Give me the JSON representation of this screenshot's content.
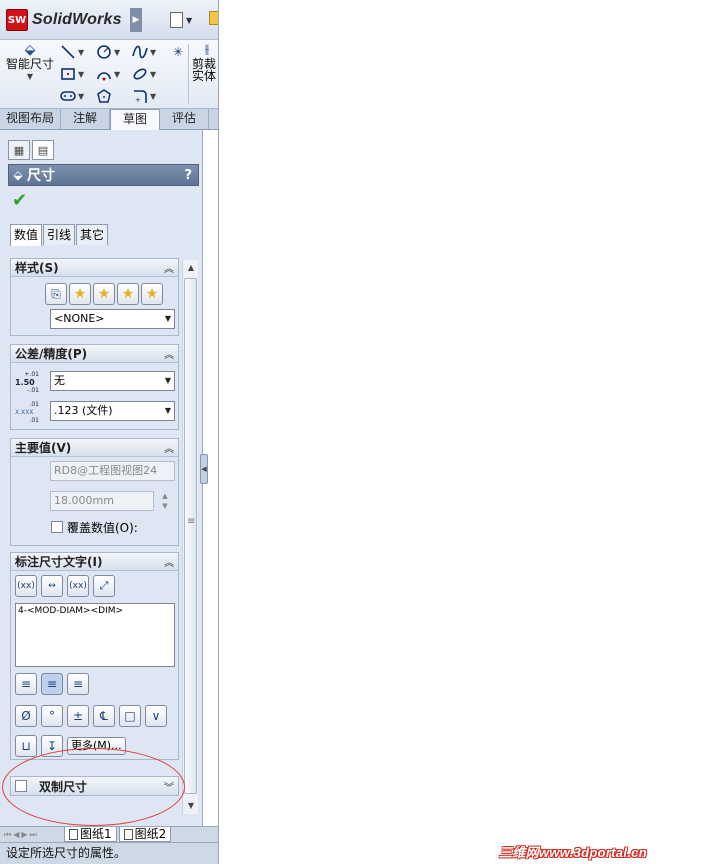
{
  "app": {
    "logo_mark": "SW",
    "name": "SolidWorks"
  },
  "ribbon": {
    "smart_dimension": "智能尺寸",
    "trim": "剪裁实体"
  },
  "command_tabs": [
    "视图布局",
    "注解",
    "草图",
    "评估"
  ],
  "active_command_tab": "草图",
  "property_manager": {
    "title": "尺寸",
    "help": "?",
    "tabs": [
      "数值",
      "引线",
      "其它"
    ],
    "style_group": {
      "title": "样式(S)",
      "dropdown": "<NONE>"
    },
    "tolerance_group": {
      "title": "公差/精度(P)",
      "tol_icon_top": "+.01",
      "tol_icon_mid": "1.50",
      "tol_icon_bot": "-.01",
      "tolerance_value": "无",
      "prec_icon_top": ".01",
      "prec_icon_mid": "X.XXX",
      "prec_icon_bot": ".01",
      "precision_value": ".123 (文件)"
    },
    "primary_value_group": {
      "title": "主要值(V)",
      "name_field": "RD8@工程图视图24",
      "value_field": "18.000mm",
      "override_label": "覆盖数值(O):"
    },
    "dim_text_group": {
      "title": "标注尺寸文字(I)",
      "text": "4-<MOD-DIAM><DIM>",
      "more_button": "更多(M)..."
    },
    "dual_dim_group": {
      "title": "双制尺寸"
    }
  },
  "sheets": [
    "图纸1",
    "图纸2"
  ],
  "status_text": "设定所选尺寸的属性。",
  "watermark": "三维网www.3dportal.cn",
  "colors": {
    "header": "#6b7f9e",
    "annotation": "#e23b3b",
    "check": "#2aa52a"
  }
}
